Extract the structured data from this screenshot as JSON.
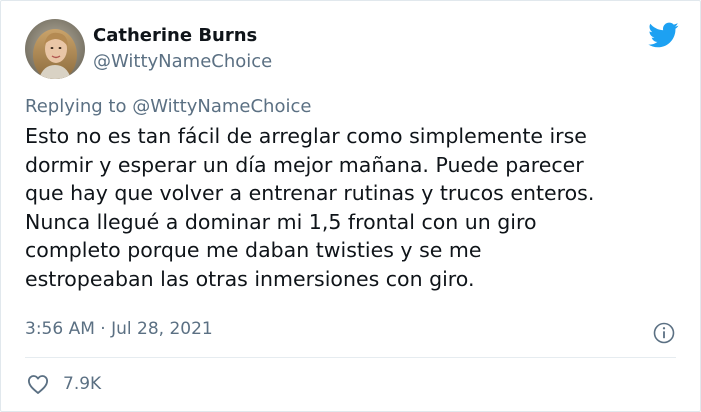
{
  "author": {
    "name": "Catherine Burns",
    "handle": "@WittyNameChoice"
  },
  "reply": {
    "prefix": "Replying to ",
    "mention": "@WittyNameChoice"
  },
  "tweet": {
    "lines": [
      "Esto no es tan fácil de arreglar como simplemente irse",
      "dormir y esperar un día mejor mañana. Puede parecer",
      "que hay que volver a entrenar rutinas y trucos enteros.",
      "Nunca llegué a dominar mi 1,5 frontal con un giro",
      "completo porque me daban twisties y se me",
      "estropeaban las otras inmersiones con giro."
    ]
  },
  "meta": {
    "timestamp": "3:56 AM · Jul 28, 2021"
  },
  "stats": {
    "likes": "7.9K"
  },
  "icons": {
    "logo": "twitter-bird-icon",
    "info": "info-icon",
    "like": "heart-icon"
  },
  "colors": {
    "twitter_blue": "#1da1f2",
    "secondary_text": "#5b7083",
    "primary_text": "#0f1419"
  }
}
